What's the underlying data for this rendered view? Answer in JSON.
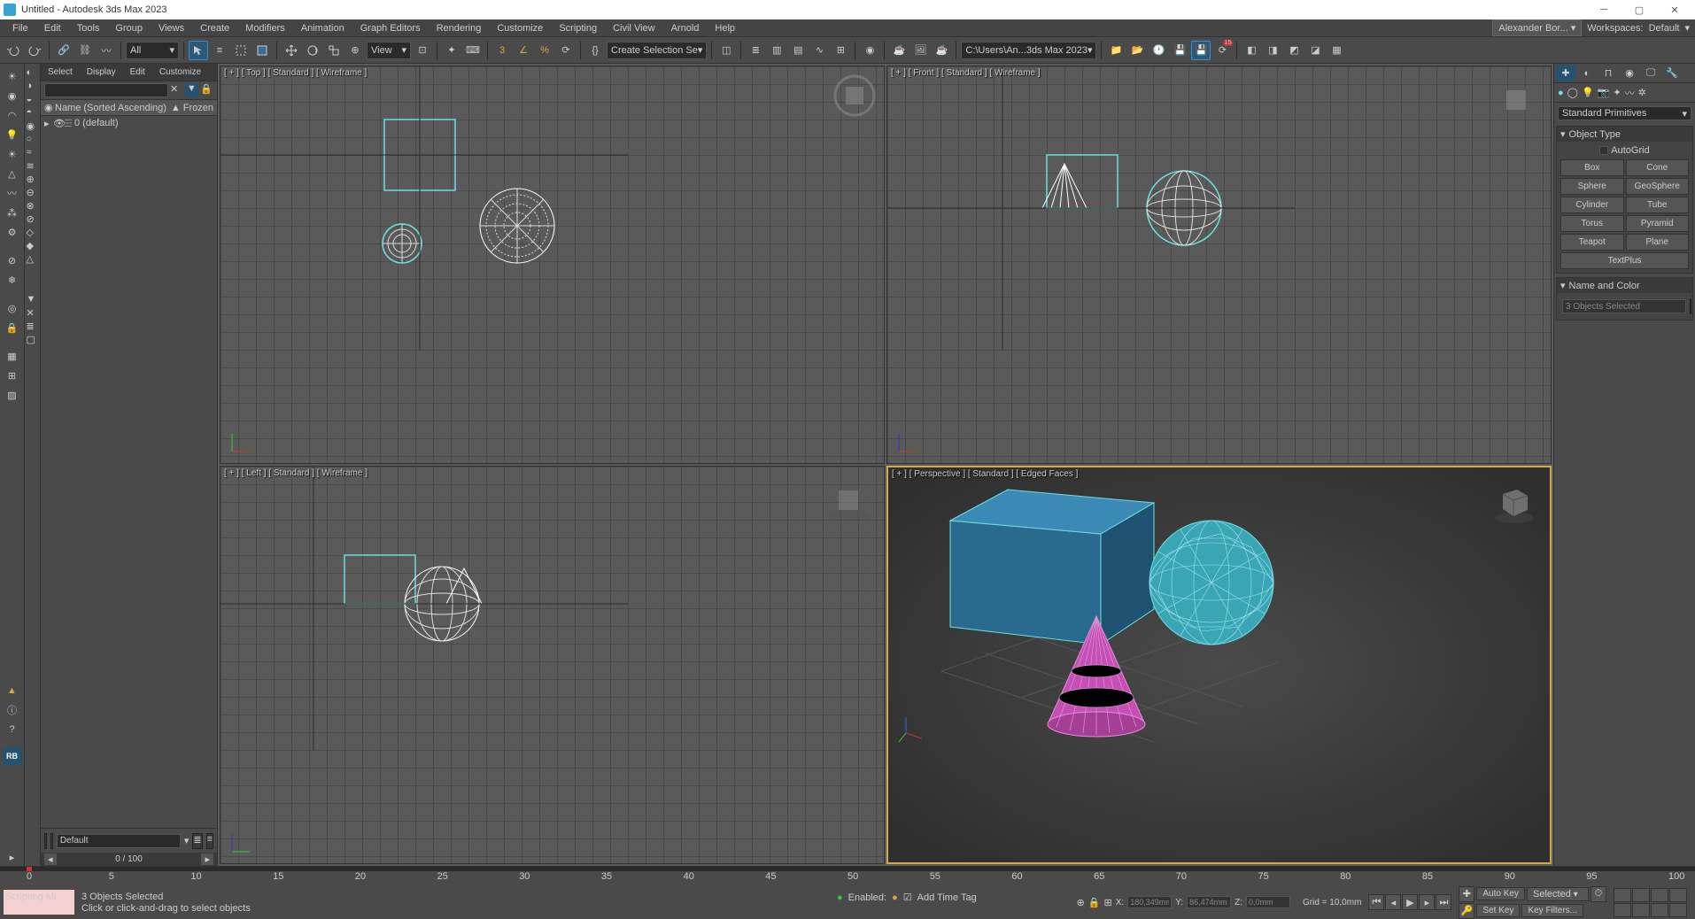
{
  "app": {
    "title": "Untitled - Autodesk 3ds Max 2023",
    "user": "Alexander Bor...",
    "workspace_label": "Workspaces:",
    "workspace_value": "Default"
  },
  "menus": [
    "File",
    "Edit",
    "Tools",
    "Group",
    "Views",
    "Create",
    "Modifiers",
    "Animation",
    "Graph Editors",
    "Rendering",
    "Customize",
    "Scripting",
    "Civil View",
    "Arnold",
    "Help"
  ],
  "toolbar": {
    "all_filter": "All",
    "view_label": "View",
    "sel_set": "Create Selection Se",
    "path": "C:\\Users\\An...3ds Max 2023",
    "recent_badge": "15"
  },
  "scene": {
    "tabs": [
      "Select",
      "Display",
      "Edit",
      "Customize"
    ],
    "header_col1": "Name (Sorted Ascending)",
    "header_col2": "▲ Frozen",
    "items": [
      {
        "label": "0 (default)"
      }
    ],
    "layer_dropdown": "Default"
  },
  "viewports": {
    "top": "[ + ] [ Top ] [ Standard ] [ Wireframe ]",
    "front": "[ + ] [ Front ] [ Standard ] [ Wireframe ]",
    "left": "[ + ] [ Left ] [ Standard ] [ Wireframe ]",
    "persp": "[ + ] [ Perspective ] [ Standard ] [ Edged Faces ]"
  },
  "cmd": {
    "category": "Standard Primitives",
    "rollout_objtype": "Object Type",
    "autogrid": "AutoGrid",
    "objbtns": [
      "Box",
      "Cone",
      "Sphere",
      "GeoSphere",
      "Cylinder",
      "Tube",
      "Torus",
      "Pyramid",
      "Teapot",
      "Plane",
      "TextPlus"
    ],
    "rollout_name": "Name and Color",
    "name_value": "3 Objects Selected"
  },
  "time": {
    "frame_label": "0 / 100",
    "ruler": [
      0,
      5,
      10,
      15,
      20,
      25,
      30,
      35,
      40,
      45,
      50,
      55,
      60,
      65,
      70,
      75,
      80,
      85,
      90,
      95,
      100
    ]
  },
  "status": {
    "script_label": "Scripting Mi",
    "msg1": "3 Objects Selected",
    "msg2": "Click or click-and-drag to select objects",
    "coords": {
      "x_label": "X:",
      "x": "180,349mm",
      "y_label": "Y:",
      "y": "86,474mm",
      "z_label": "Z:",
      "z": "0,0mm",
      "grid": "Grid = 10,0mm"
    },
    "keys": {
      "autokey": "Auto Key",
      "setkey": "Set Key",
      "selected": "Selected",
      "filters": "Key Filters..."
    },
    "enabled_label": "Enabled:",
    "addtime": "Add Time Tag"
  }
}
